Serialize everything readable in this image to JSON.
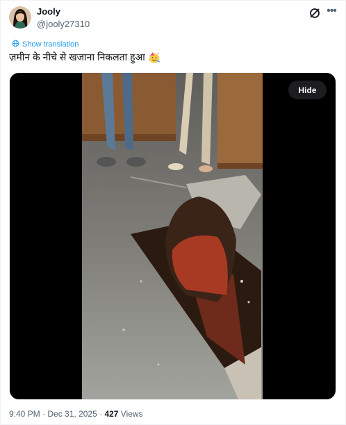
{
  "author": {
    "name": "Jooly",
    "handle": "@jooly27310"
  },
  "icons": {
    "grok": "grok-icon",
    "more": "more-options-icon",
    "translate": "globe-icon",
    "emoji": "party-face-emoji"
  },
  "translation": {
    "label": "Show translation"
  },
  "tweet": {
    "text": "ज़मीन के नीचे से खजाना निकलता हुआ"
  },
  "media": {
    "hide_label": "Hide"
  },
  "meta": {
    "time": "9:40 PM",
    "sep1": " · ",
    "date": "Dec 31, 2025",
    "sep2": " · ",
    "views_count": "427",
    "views_label": " Views"
  },
  "colors": {
    "accent": "#1d9bf0",
    "secondary": "#536471",
    "text": "#0f1419"
  }
}
